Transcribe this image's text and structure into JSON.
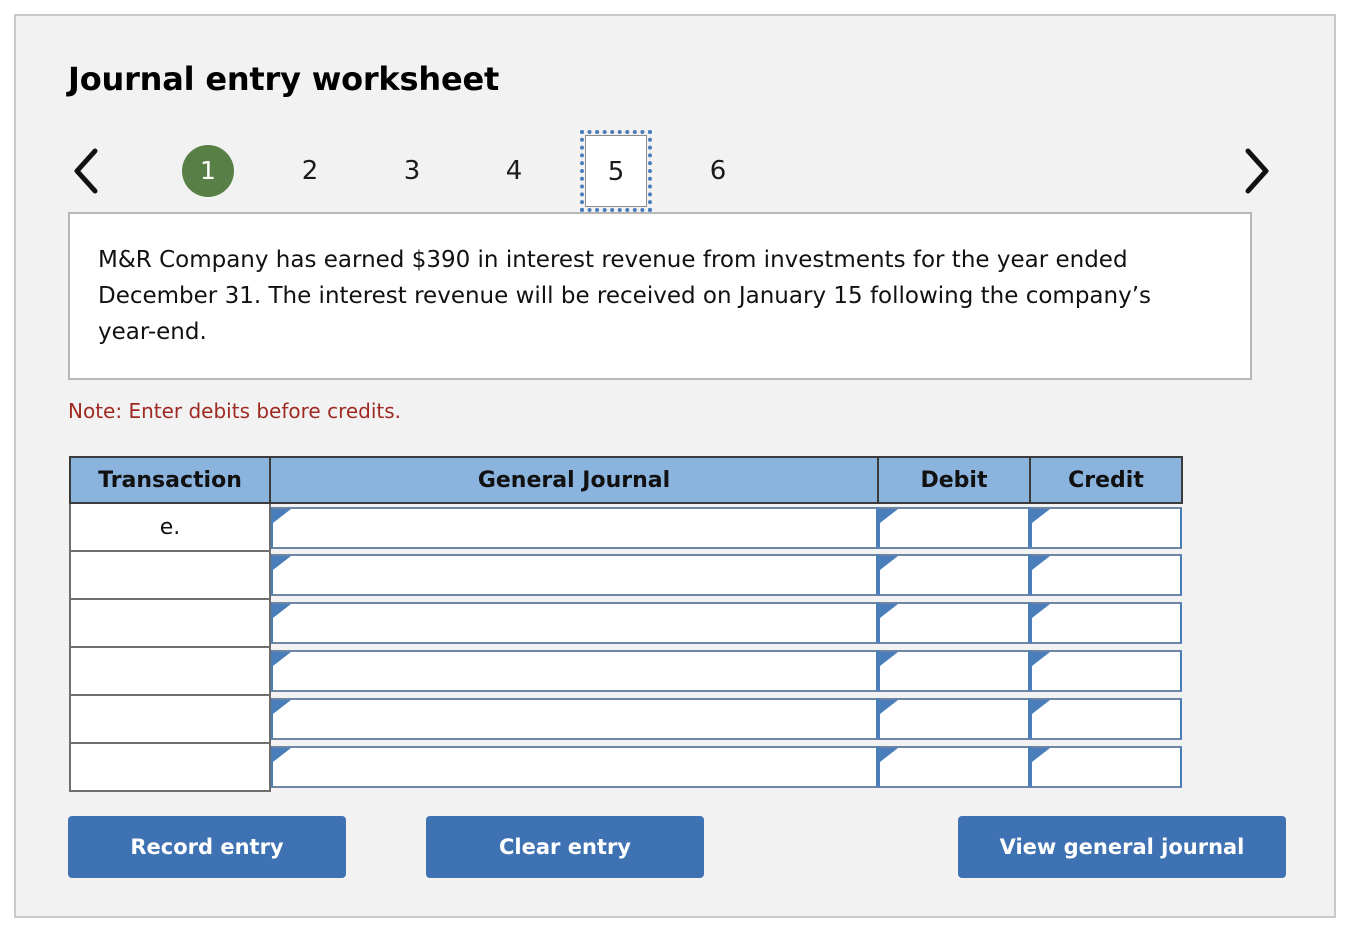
{
  "worksheet": {
    "title": "Journal entry worksheet",
    "note": "Note: Enter debits before credits.",
    "question": "M&R Company has earned $390 in interest revenue from investments for the year ended December 31. The interest revenue will be received on January 15 following the company’s year-end."
  },
  "pager": {
    "prev_label": "‹",
    "next_label": "›",
    "tabs": [
      {
        "label": "1",
        "state": "current"
      },
      {
        "label": "2",
        "state": "normal"
      },
      {
        "label": "3",
        "state": "normal"
      },
      {
        "label": "4",
        "state": "normal"
      },
      {
        "label": "5",
        "state": "focused"
      },
      {
        "label": "6",
        "state": "normal"
      }
    ]
  },
  "table": {
    "headers": [
      "Transaction",
      "General Journal",
      "Debit",
      "Credit"
    ],
    "rows": [
      {
        "transaction": "e.",
        "general_journal": "",
        "debit": "",
        "credit": ""
      },
      {
        "transaction": "",
        "general_journal": "",
        "debit": "",
        "credit": ""
      },
      {
        "transaction": "",
        "general_journal": "",
        "debit": "",
        "credit": ""
      },
      {
        "transaction": "",
        "general_journal": "",
        "debit": "",
        "credit": ""
      },
      {
        "transaction": "",
        "general_journal": "",
        "debit": "",
        "credit": ""
      },
      {
        "transaction": "",
        "general_journal": "",
        "debit": "",
        "credit": ""
      }
    ]
  },
  "buttons": {
    "record": "Record entry",
    "clear": "Clear entry",
    "view": "View general journal"
  },
  "colors": {
    "panel_bg": "#f2f2f2",
    "header_blue": "#8ab3de",
    "button_blue": "#3f72b3",
    "current_tab_green": "#587f46",
    "note_red": "#9f2a22",
    "focus_ring_blue": "#4a7ebb"
  }
}
